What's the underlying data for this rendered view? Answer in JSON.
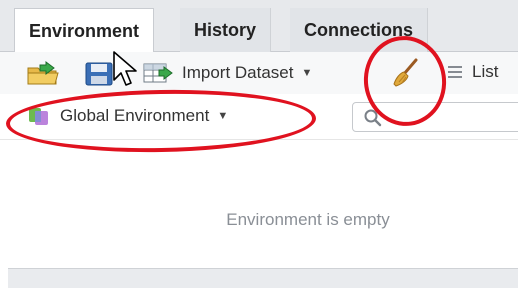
{
  "tabs": [
    {
      "label": "Environment",
      "active": true
    },
    {
      "label": "History",
      "active": false
    },
    {
      "label": "Connections",
      "active": false
    }
  ],
  "toolbar": {
    "import_label": "Import Dataset",
    "list_label": "List",
    "icons": [
      "open-folder-icon",
      "save-icon",
      "import-table-icon",
      "broom-icon",
      "list-icon"
    ]
  },
  "environment_selector": {
    "label": "Global Environment",
    "icon": "r-environment-icon"
  },
  "search": {
    "placeholder": ""
  },
  "main": {
    "empty_message": "Environment is empty"
  },
  "colors": {
    "annotation_red": "#e0121f",
    "tab_bg": "#e7e9ec",
    "text_muted": "#8a8f96"
  }
}
